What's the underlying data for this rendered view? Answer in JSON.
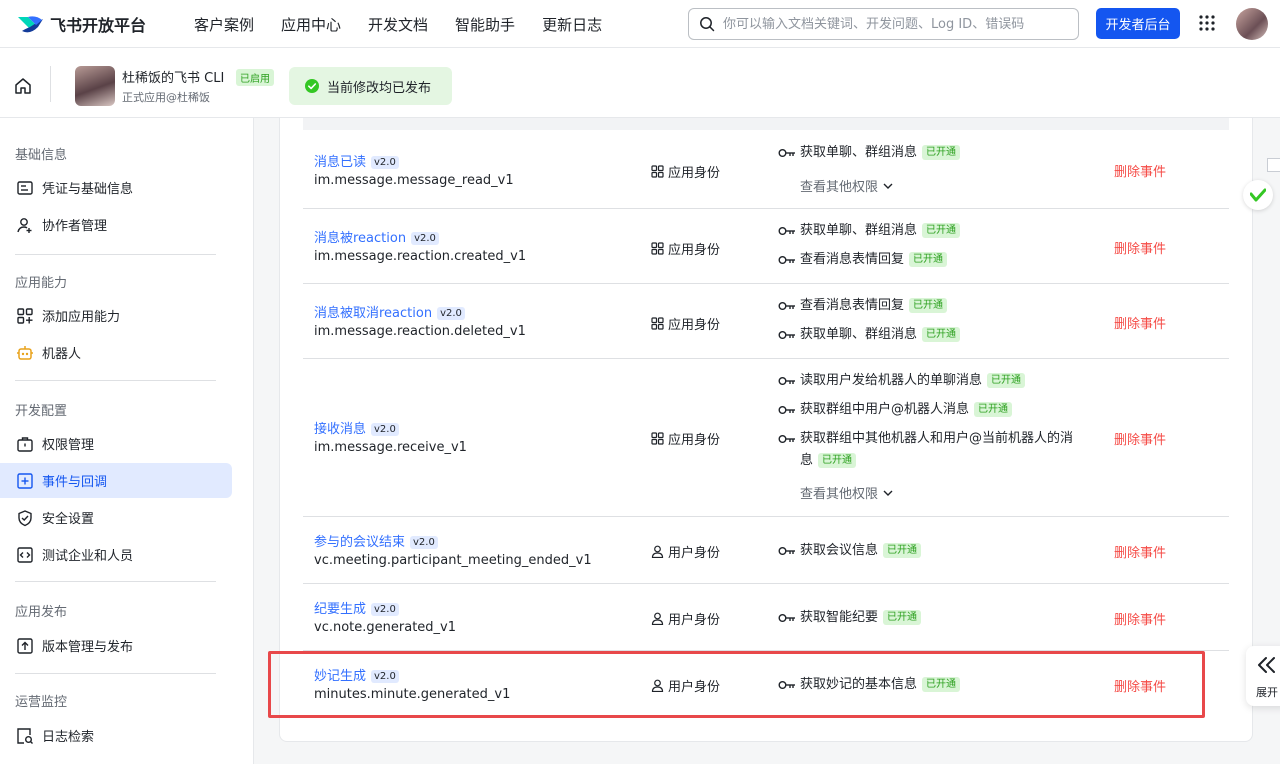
{
  "brand": {
    "name": "飞书开放平台"
  },
  "nav": [
    "客户案例",
    "应用中心",
    "开发文档",
    "智能助手",
    "更新日志"
  ],
  "search": {
    "placeholder": "你可以输入文档关键词、开发问题、Log ID、错误码"
  },
  "dev_console_label": "开发者后台",
  "app": {
    "name": "杜稀饭的飞书 CLI",
    "status": "已启用",
    "subtitle": "正式应用@杜稀饭"
  },
  "publish_status": "当前修改均已发布",
  "sidebar": {
    "sections": [
      {
        "title": "基础信息",
        "items": [
          "凭证与基础信息",
          "协作者管理"
        ]
      },
      {
        "title": "应用能力",
        "items": [
          "添加应用能力",
          "机器人"
        ]
      },
      {
        "title": "开发配置",
        "items": [
          "权限管理",
          "事件与回调",
          "安全设置",
          "测试企业和人员"
        ]
      },
      {
        "title": "应用发布",
        "items": [
          "版本管理与发布"
        ]
      },
      {
        "title": "运营监控",
        "items": [
          "日志检索"
        ]
      }
    ],
    "active_item": "事件与回调"
  },
  "labels": {
    "enabled": "已开通",
    "view_more": "查看其他权限",
    "delete": "删除事件",
    "version": "v2.0"
  },
  "events": [
    {
      "name": "消息已读",
      "key": "im.message.message_read_v1",
      "identity": "应用身份",
      "permissions": [
        "获取单聊、群组消息"
      ],
      "more": true
    },
    {
      "name": "消息被reaction",
      "key": "im.message.reaction.created_v1",
      "identity": "应用身份",
      "permissions": [
        "获取单聊、群组消息",
        "查看消息表情回复"
      ],
      "more": false
    },
    {
      "name": "消息被取消reaction",
      "key": "im.message.reaction.deleted_v1",
      "identity": "应用身份",
      "permissions": [
        "查看消息表情回复",
        "获取单聊、群组消息"
      ],
      "more": false
    },
    {
      "name": "接收消息",
      "key": "im.message.receive_v1",
      "identity": "应用身份",
      "permissions": [
        "读取用户发给机器人的单聊消息",
        "获取群组中用户@机器人消息",
        "获取群组中其他机器人和用户@当前机器人的消息"
      ],
      "more": true
    },
    {
      "name": "参与的会议结束",
      "key": "vc.meeting.participant_meeting_ended_v1",
      "identity": "用户身份",
      "permissions": [
        "获取会议信息"
      ],
      "more": false
    },
    {
      "name": "纪要生成",
      "key": "vc.note.generated_v1",
      "identity": "用户身份",
      "permissions": [
        "获取智能纪要"
      ],
      "more": false
    },
    {
      "name": "妙记生成",
      "key": "minutes.minute.generated_v1",
      "identity": "用户身份",
      "permissions": [
        "获取妙记的基本信息"
      ],
      "more": false
    }
  ],
  "expand_label": "展开"
}
